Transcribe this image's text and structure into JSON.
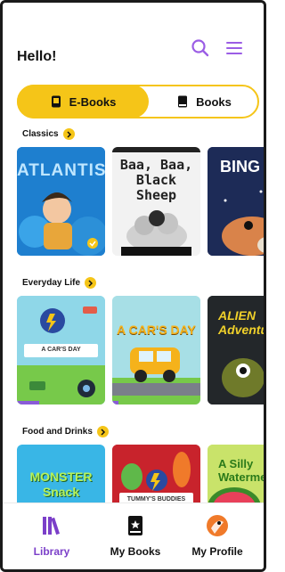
{
  "header": {
    "greeting": "Hello!",
    "search_icon": "search-icon",
    "menu_icon": "hamburger-menu-icon",
    "accent": "#9b5de5"
  },
  "tabs": [
    {
      "label": "E-Books",
      "icon": "tablet-icon",
      "active": true
    },
    {
      "label": "Books",
      "icon": "book-icon",
      "active": false
    }
  ],
  "sections": [
    {
      "title": "Classics",
      "cards": [
        {
          "title": "ATLANTIS",
          "bg": "#1e7fcf",
          "completed": true
        },
        {
          "title": "Baa, Baa, Black Sheep",
          "bg": "#f2f2f2"
        },
        {
          "title": "BING",
          "bg": "#1d2b57"
        }
      ]
    },
    {
      "title": "Everyday Life",
      "cards": [
        {
          "title": "A CAR'S DAY",
          "bg": "#8fd7e8",
          "progress": 0.25
        },
        {
          "title": "A CAR'S DAY",
          "bg": "#a7dfe6",
          "progress": 0.07
        },
        {
          "title": "ALIEN Adventure",
          "bg": "#23272a"
        }
      ]
    },
    {
      "title": "Food and Drinks",
      "cards": [
        {
          "title": "MONSTER Snack",
          "bg": "#39b6e6"
        },
        {
          "title": "TUMMY'S BUDDIES",
          "bg": "#c8232c"
        },
        {
          "title": "A Silly Watermelon",
          "bg": "#c9e36a"
        }
      ]
    }
  ],
  "tabbar": [
    {
      "label": "Library",
      "icon": "library-icon",
      "active": true,
      "color": "#7b3fc9"
    },
    {
      "label": "My Books",
      "icon": "my-books-icon",
      "active": false,
      "color": "#111111"
    },
    {
      "label": "My Profile",
      "icon": "profile-avatar-icon",
      "active": false,
      "color": "#111111"
    }
  ]
}
